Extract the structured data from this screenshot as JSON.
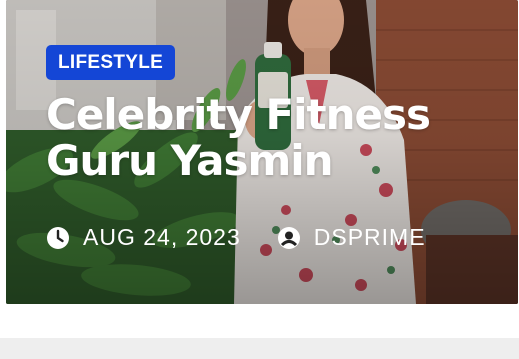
{
  "post": {
    "category": "LIFESTYLE",
    "title": "Celebrity Fitness Guru Yasmin",
    "date": "AUG 24, 2023",
    "author": "DSPRIME"
  },
  "icons": {
    "date": "clock-icon",
    "author": "user-circle-icon"
  },
  "colors": {
    "badge": "#1446d6",
    "text": "#ffffff"
  }
}
